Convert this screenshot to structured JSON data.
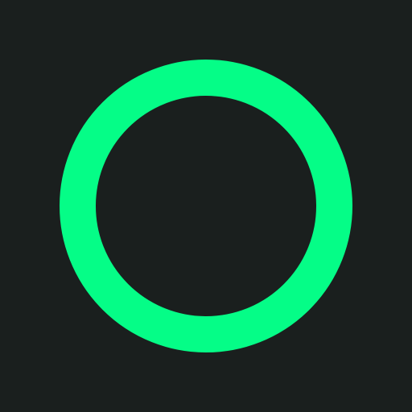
{
  "colors": {
    "background": "#1a1f1e",
    "ring": "#05fd87"
  },
  "icon": {
    "name": "circle-ring-icon"
  }
}
